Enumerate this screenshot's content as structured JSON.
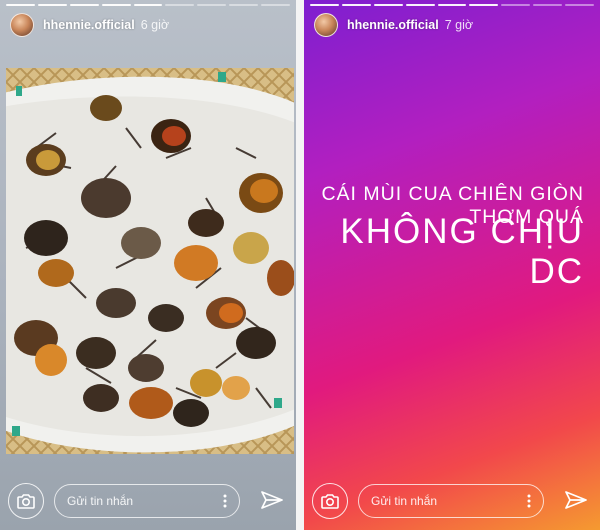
{
  "stories": [
    {
      "username": "hhennie.official",
      "time": "6 giờ",
      "reply_placeholder": "Gửi tin nhắn"
    },
    {
      "username": "hhennie.official",
      "time": "7 giờ",
      "caption_line1": "CÁI MÙI CUA CHIÊN GIÒN THƠM QUÁ",
      "caption_line2": "KHÔNG CHỊU DC",
      "reply_placeholder": "Gửi tin nhắn"
    }
  ],
  "icons": [
    "camera-icon",
    "more-vertical-icon",
    "send-icon"
  ],
  "colors": {
    "gradient_start": "#7e1fd0",
    "gradient_mid": "#e11a7e",
    "gradient_end": "#f59a30"
  }
}
